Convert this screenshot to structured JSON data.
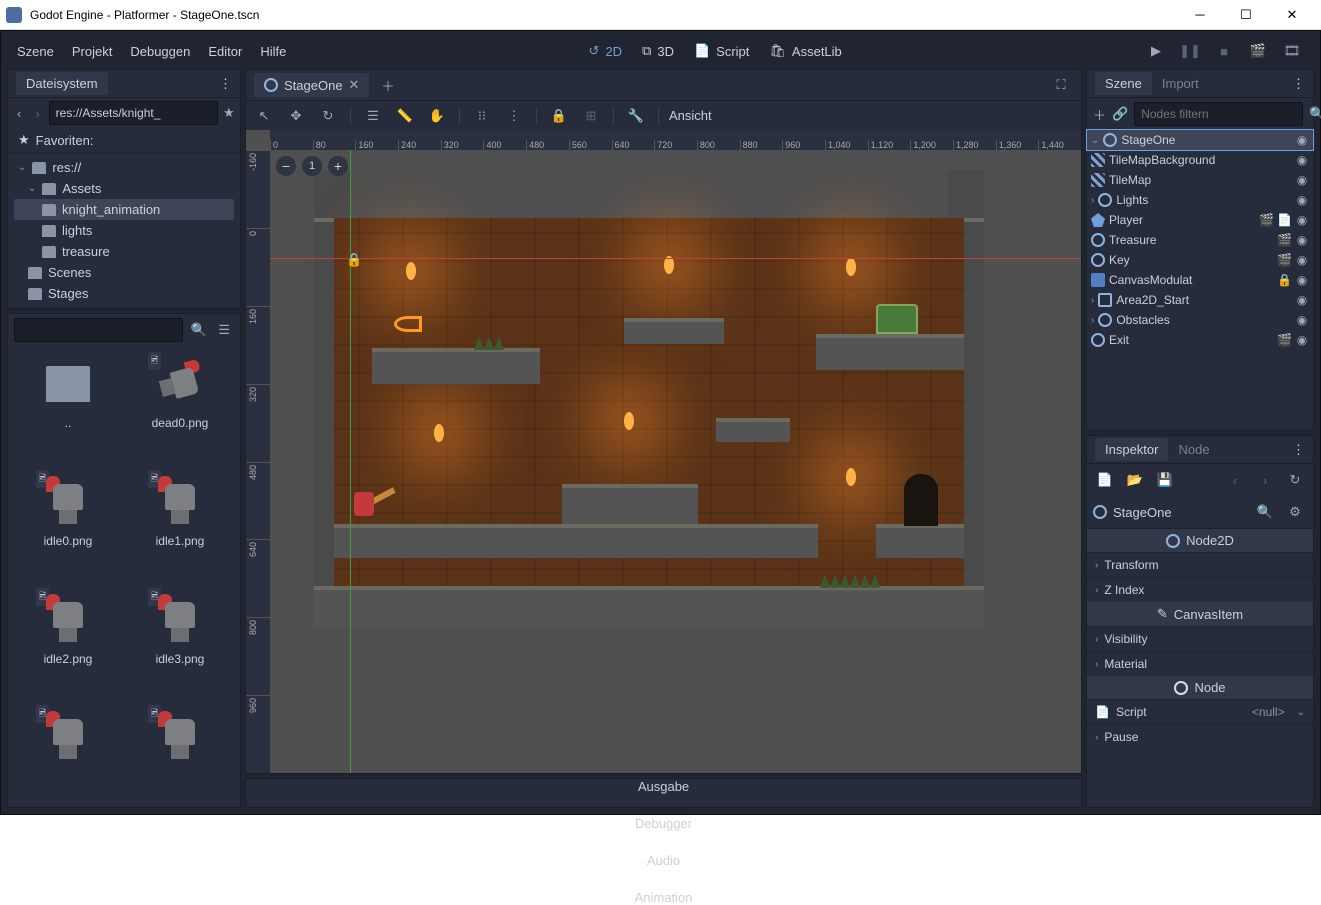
{
  "window": {
    "title": "Godot Engine - Platformer - StageOne.tscn"
  },
  "menu": {
    "scene": "Szene",
    "project": "Projekt",
    "debug": "Debuggen",
    "editor": "Editor",
    "help": "Hilfe"
  },
  "workspaces": {
    "d2": "2D",
    "d3": "3D",
    "script": "Script",
    "assetlib": "AssetLib"
  },
  "filesystem": {
    "title": "Dateisystem",
    "path": "res://Assets/knight_",
    "favorites": "Favoriten:",
    "tree": {
      "root": "res://",
      "assets": "Assets",
      "knight_anim": "knight_animation",
      "lights": "lights",
      "treasure": "treasure",
      "scenes": "Scenes",
      "stages": "Stages"
    },
    "thumbs": [
      "..",
      "dead0.png",
      "idle0.png",
      "idle1.png",
      "idle2.png",
      "idle3.png"
    ]
  },
  "scene_tab": "StageOne",
  "view_menu": "Ansicht",
  "ruler_h": [
    "0",
    "80",
    "160",
    "240",
    "320",
    "400",
    "480",
    "560",
    "640",
    "720",
    "800",
    "880",
    "960",
    "1,040",
    "1,120",
    "1,200",
    "1,280",
    "1,360",
    "1,440"
  ],
  "ruler_v": [
    "-160",
    "0",
    "160",
    "320",
    "480",
    "640",
    "800",
    "960"
  ],
  "scene_panel": {
    "tab_scene": "Szene",
    "tab_import": "Import",
    "filter_placeholder": "Nodes filtern",
    "nodes": {
      "root": "StageOne",
      "tmbg": "TileMapBackground",
      "tm": "TileMap",
      "lights": "Lights",
      "player": "Player",
      "treasure": "Treasure",
      "key": "Key",
      "canvasmod": "CanvasModulat",
      "area": "Area2D_Start",
      "obstacles": "Obstacles",
      "exit": "Exit"
    }
  },
  "inspector": {
    "tab_insp": "Inspektor",
    "tab_node": "Node",
    "obj": "StageOne",
    "sect_node2d": "Node2D",
    "transform": "Transform",
    "zindex": "Z Index",
    "sect_canvas": "CanvasItem",
    "visibility": "Visibility",
    "material": "Material",
    "sect_node": "Node",
    "script": "Script",
    "script_val": "<null>",
    "pause": "Pause"
  },
  "bottom": {
    "output": "Ausgabe",
    "debugger": "Debugger",
    "audio": "Audio",
    "animation": "Animation"
  }
}
